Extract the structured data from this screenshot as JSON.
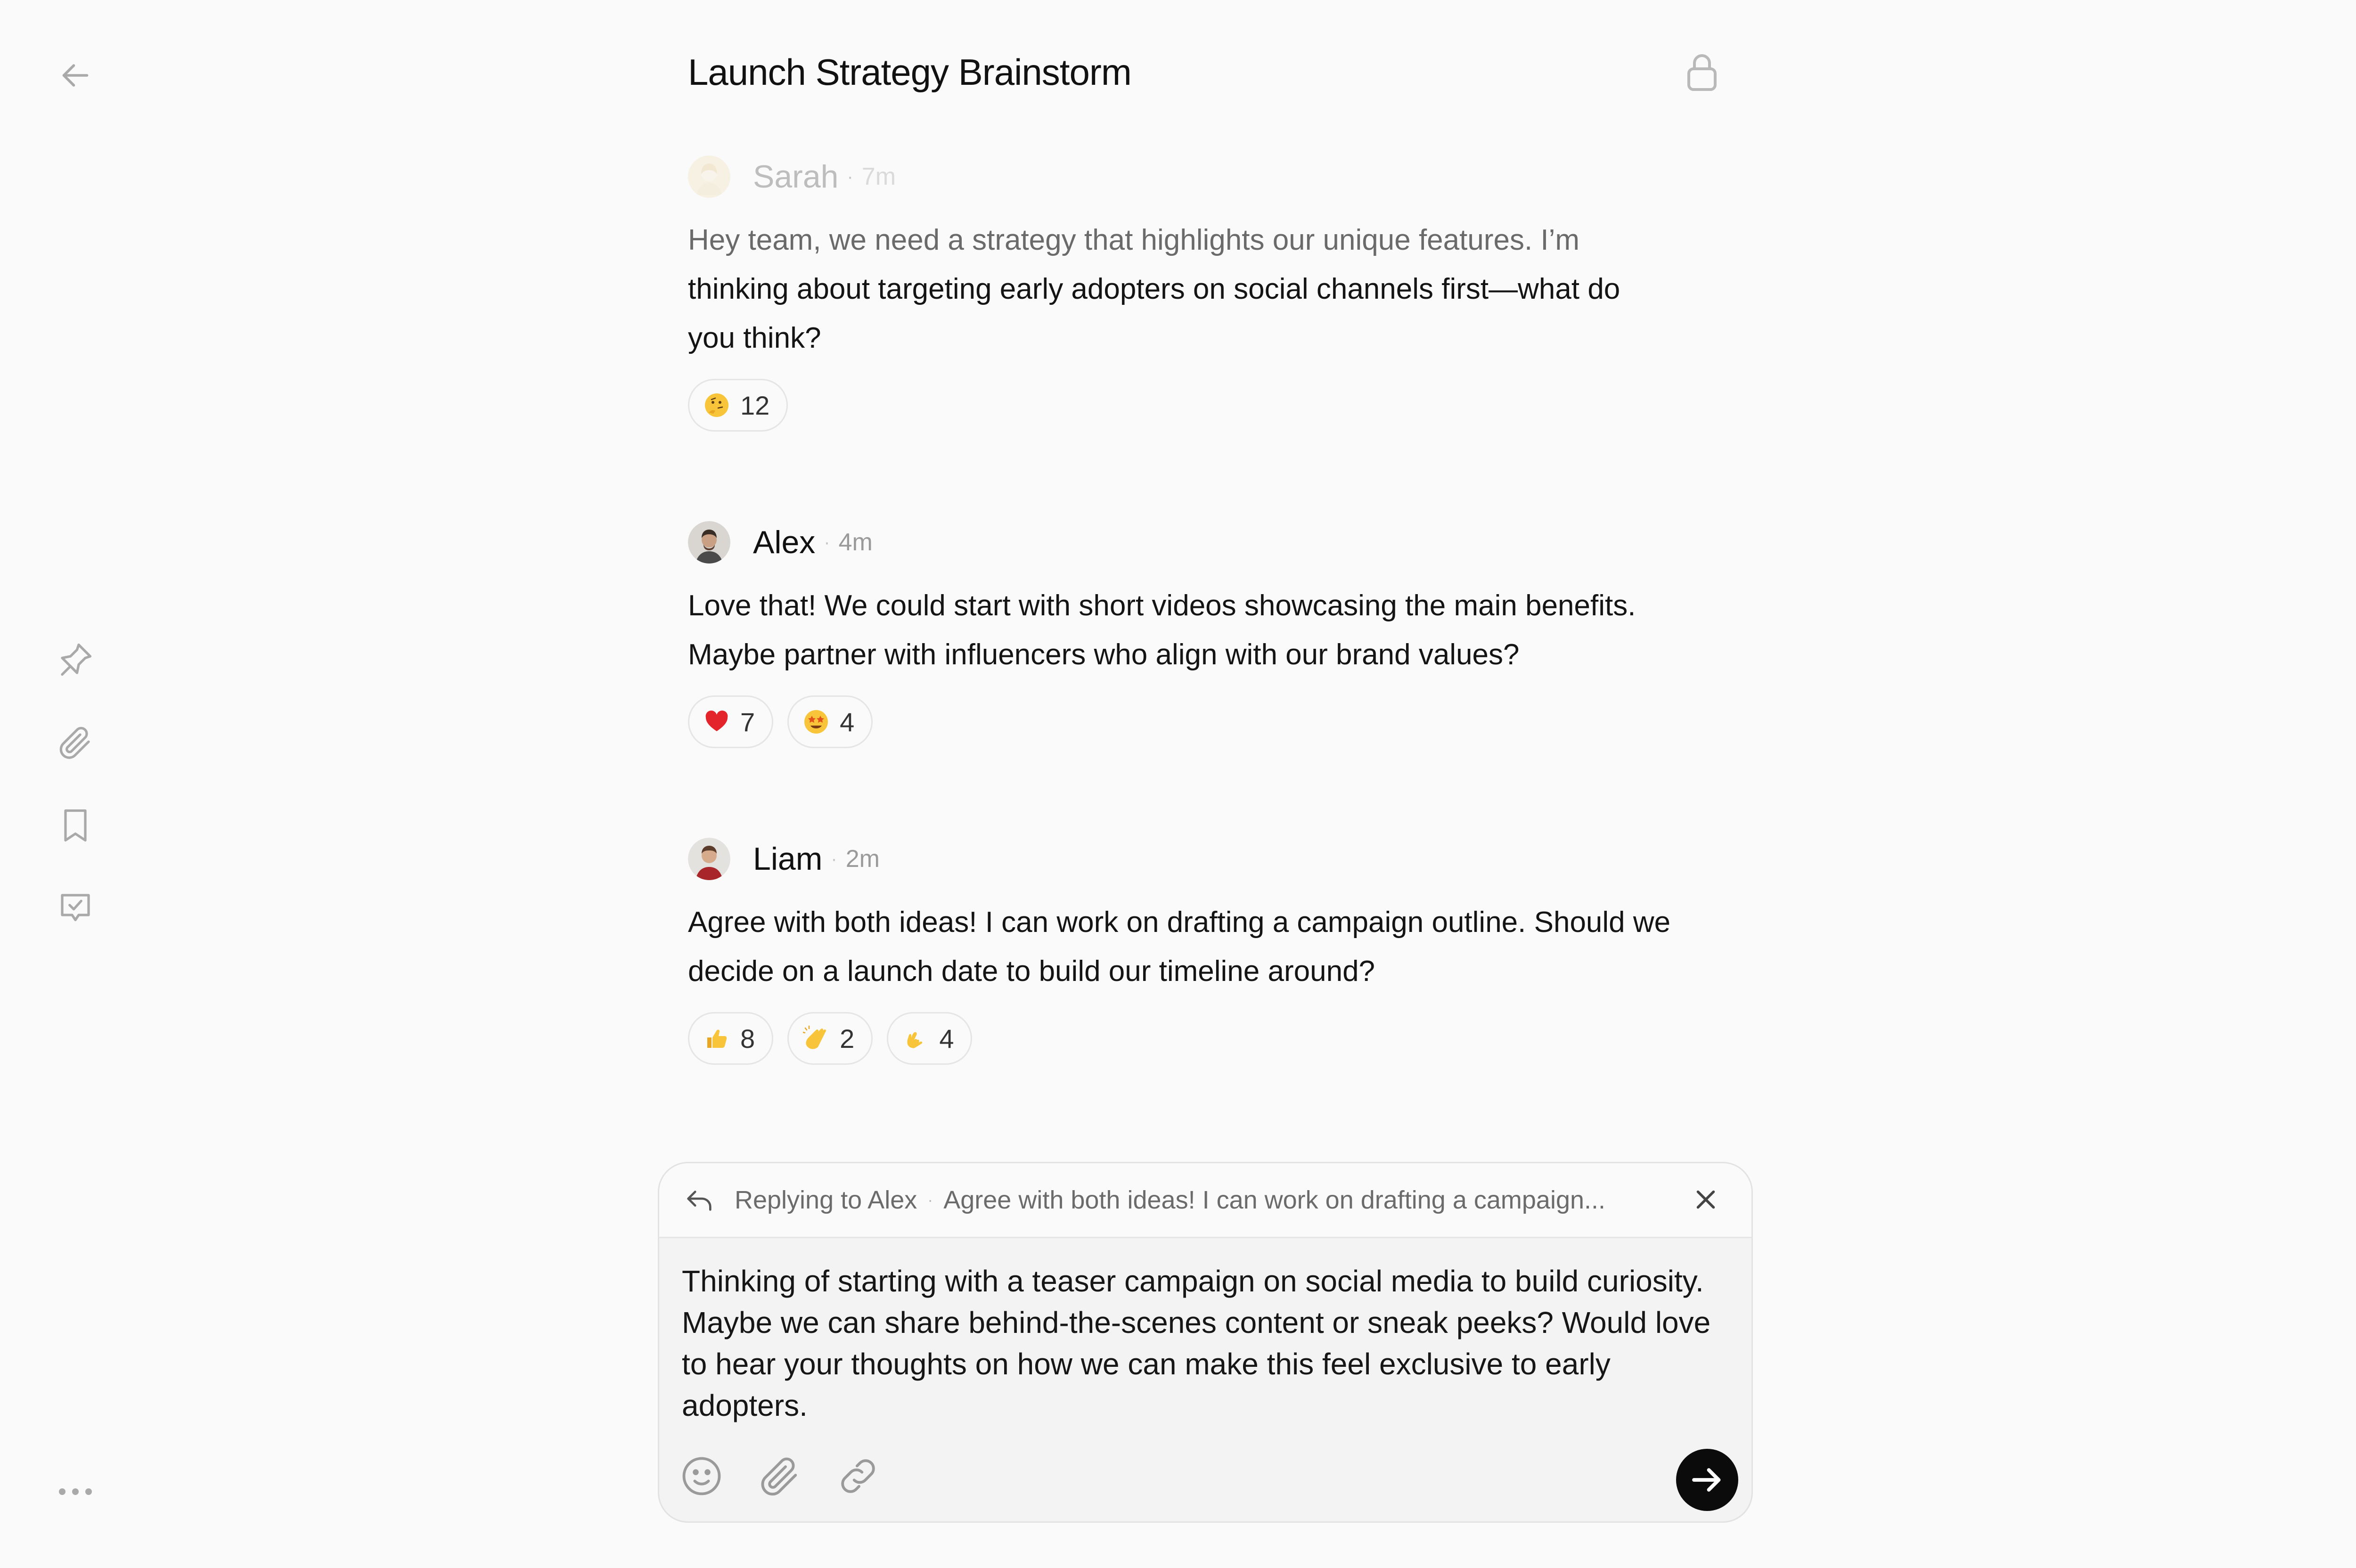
{
  "conversation": {
    "title": "Launch Strategy Brainstorm"
  },
  "rail": {
    "items": [
      "back-icon",
      "pin-icon",
      "paperclip-icon",
      "bookmark-icon",
      "task-check-icon",
      "more-icon"
    ]
  },
  "messages": [
    {
      "author": "Sarah",
      "time": "7m",
      "text_lines": [
        "Hey team, we need a strategy that highlights our unique features. I’m",
        "thinking about targeting early adopters on social channels first—what do",
        "you think?"
      ],
      "reactions": [
        {
          "emoji": "thinking-face",
          "count": "12"
        }
      ]
    },
    {
      "author": "Alex",
      "time": "4m",
      "text_lines": [
        "Love that! We could start with short videos showcasing the main benefits.",
        "Maybe partner with influencers who align with our brand values?"
      ],
      "reactions": [
        {
          "emoji": "red-heart",
          "count": "7"
        },
        {
          "emoji": "star-struck",
          "count": "4"
        }
      ]
    },
    {
      "author": "Liam",
      "time": "2m",
      "text_lines": [
        "Agree with both ideas! I can work on drafting a campaign outline. Should we",
        "decide on a launch date to build our timeline around?"
      ],
      "reactions": [
        {
          "emoji": "thumbs-up",
          "count": "8"
        },
        {
          "emoji": "clapping-hands",
          "count": "2"
        },
        {
          "emoji": "ok-hand",
          "count": "4"
        }
      ]
    }
  ],
  "composer": {
    "reply_label": "Replying to Alex",
    "reply_preview": "Agree with both ideas! I can work on drafting a campaign...",
    "text_lines": [
      "Thinking of starting with a teaser campaign on social media to build curiosity.",
      "Maybe we can share behind-the-scenes content or sneak peeks? Would love",
      "to hear your thoughts on how we can make this feel exclusive to early",
      "adopters."
    ],
    "tools": [
      "emoji-icon",
      "attachment-icon",
      "link-icon"
    ],
    "send_icon": "arrow-right-icon"
  },
  "colors": {
    "background": "#fafafa",
    "text": "#111111",
    "muted": "#9a9a9a",
    "send_button": "#0b0b0b"
  }
}
